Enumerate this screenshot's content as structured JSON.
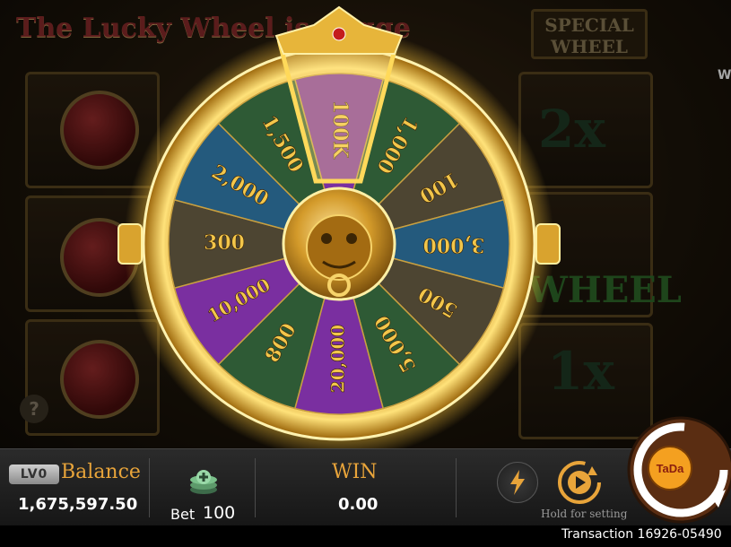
{
  "background": {
    "title_banner": "The Lucky Wheel is trigge",
    "special_banner_line1": "SPECIAL",
    "special_banner_line2": "WHEEL",
    "multiplier_top": "2x",
    "multiplier_bottom": "1x",
    "wheel_label": "WHEEL",
    "help_symbol": "?",
    "right_edge_text": "W"
  },
  "wheel": {
    "segments": [
      {
        "label": "100K",
        "color": "purple"
      },
      {
        "label": "1,000",
        "color": "green"
      },
      {
        "label": "100",
        "color": "gray"
      },
      {
        "label": "3,000",
        "color": "blue"
      },
      {
        "label": "500",
        "color": "gray"
      },
      {
        "label": "5,000",
        "color": "green"
      },
      {
        "label": "20,000",
        "color": "purple"
      },
      {
        "label": "800",
        "color": "green"
      },
      {
        "label": "10,000",
        "color": "purple"
      },
      {
        "label": "300",
        "color": "gray"
      },
      {
        "label": "2,000",
        "color": "blue"
      },
      {
        "label": "1,500",
        "color": "green"
      }
    ],
    "colors": {
      "purple": "#7a2fa0",
      "green": "#2e5a35",
      "blue": "#245a7d",
      "gray": "#4d4532",
      "rim": "#e8b83a",
      "label": "#f3c64a"
    }
  },
  "bottom_bar": {
    "level_badge": "LV0",
    "balance_label": "Balance",
    "balance_value": "1,675,597.50",
    "bet_label": "Bet",
    "bet_value": "100",
    "win_label": "WIN",
    "win_value": "0.00",
    "hold_label": "Hold for setting",
    "spin_label": "TaDa",
    "turbo_icon": "lightning-icon",
    "auto_icon": "autoplay-icon"
  },
  "transaction": {
    "text": "Transaction 16926-05490"
  }
}
